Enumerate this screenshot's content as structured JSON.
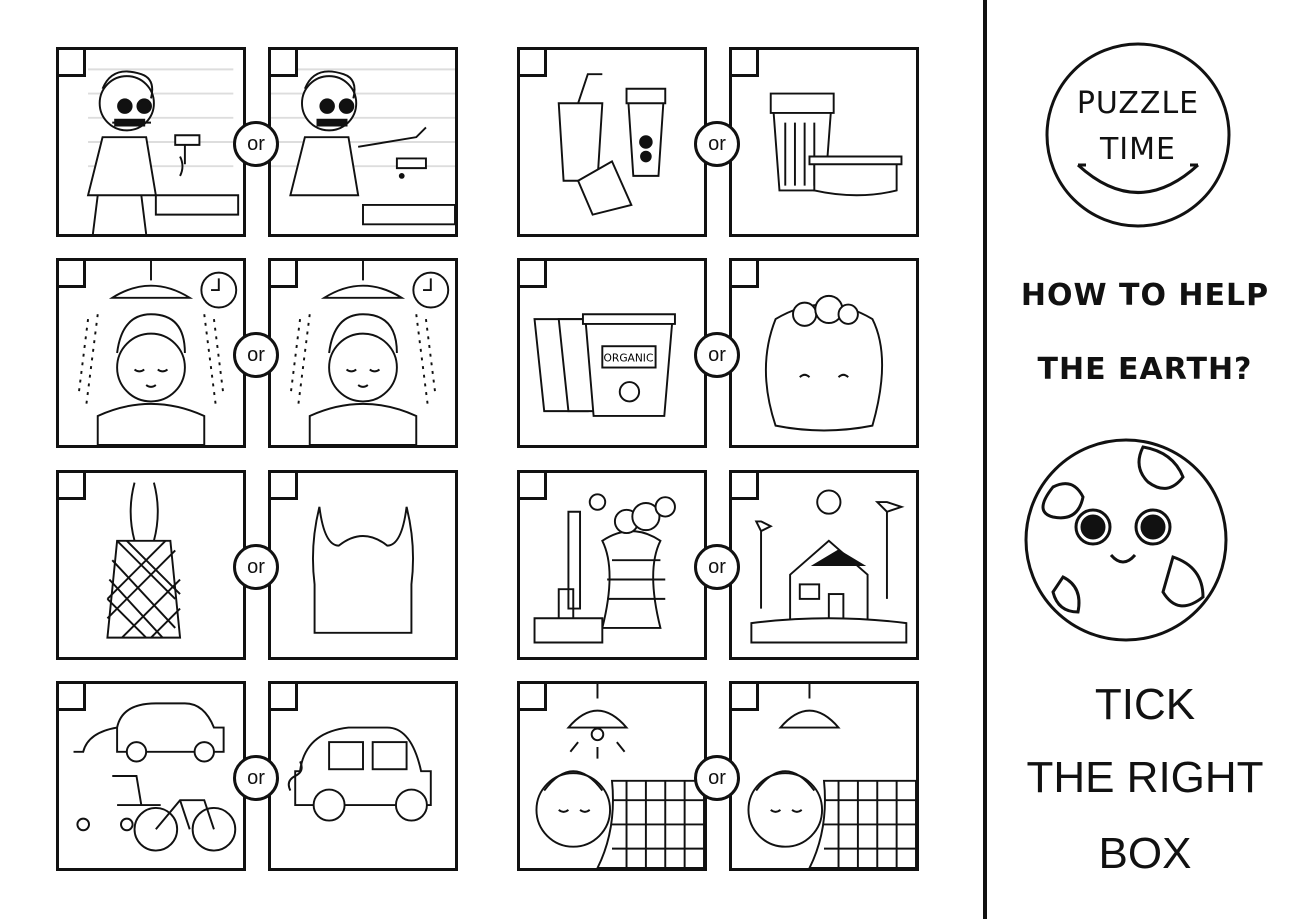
{
  "badge": {
    "line1": "PUZZLE",
    "line2": "TIME"
  },
  "heading": {
    "line1": "HOW TO HELP",
    "line2": "THE EARTH?"
  },
  "instruction": {
    "line1": "TICK",
    "line2": "THE RIGHT",
    "line3": "BOX"
  },
  "or_label": "or",
  "organic_label": "ORGANIC",
  "pairs": [
    {
      "left": "tooth-brushing-tap-running",
      "right": "tooth-brushing-tap-off"
    },
    {
      "left": "takeaway-cup-and-wrapper",
      "right": "reusable-cup-and-box"
    },
    {
      "left": "long-shower",
      "right": "short-shower"
    },
    {
      "left": "organic-bin",
      "right": "waste-bag"
    },
    {
      "left": "mesh-bag",
      "right": "plastic-bag"
    },
    {
      "left": "factory-smoke",
      "right": "green-house-windmills"
    },
    {
      "left": "electric-car-bike-scooter",
      "right": "gas-car"
    },
    {
      "left": "light-on-sleeping",
      "right": "light-off-sleeping"
    }
  ],
  "colors": {
    "ink": "#111111",
    "paper": "#ffffff"
  }
}
